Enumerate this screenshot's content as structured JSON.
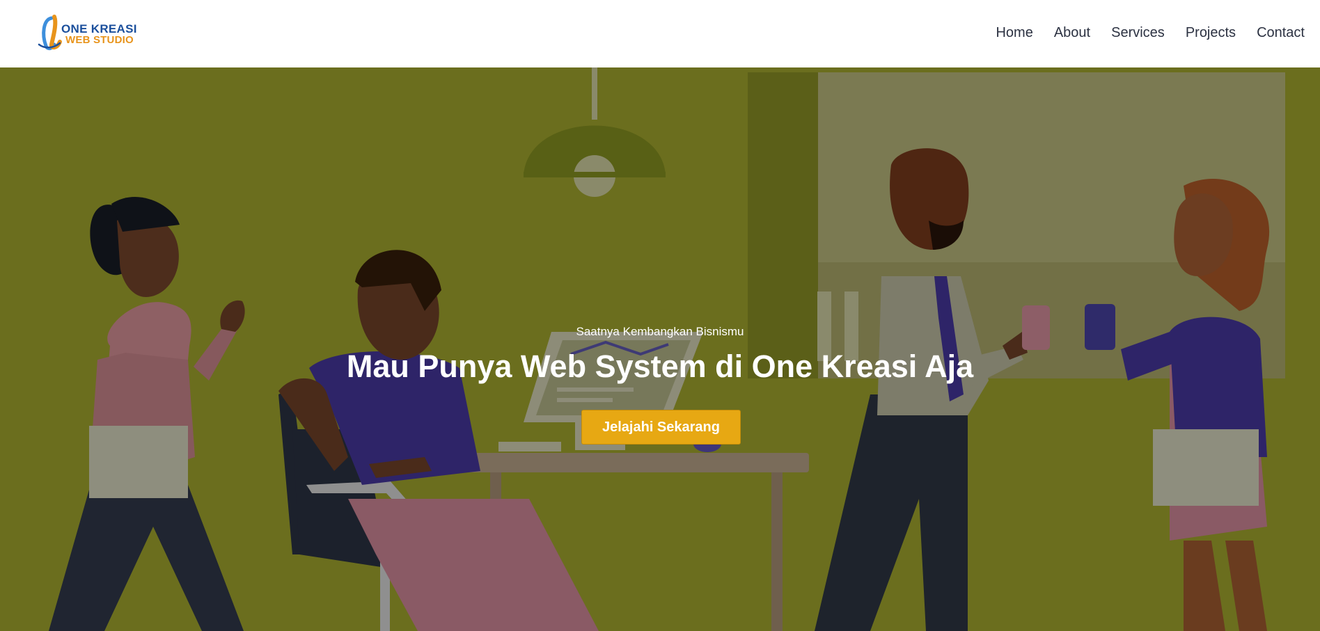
{
  "brand": {
    "line1": "ONE KREASI",
    "line2": "WEB STUDIO",
    "primary_color": "#1b4f9c",
    "secondary_color": "#e8941c"
  },
  "nav": {
    "items": [
      {
        "label": "Home",
        "icon": "none"
      },
      {
        "label": "About",
        "icon": "none"
      },
      {
        "label": "Services",
        "icon": "none"
      },
      {
        "label": "Projects",
        "icon": "none"
      },
      {
        "label": "Contact",
        "icon": "none"
      }
    ]
  },
  "hero": {
    "subtitle": "Saatnya Kembangkan Bisnismu",
    "title": "Mau Punya Web System di One Kreasi Aja",
    "button_label": "Jelajahi Sekarang",
    "overlay_color": "#6b6e1e",
    "button_color": "#e7a813"
  }
}
